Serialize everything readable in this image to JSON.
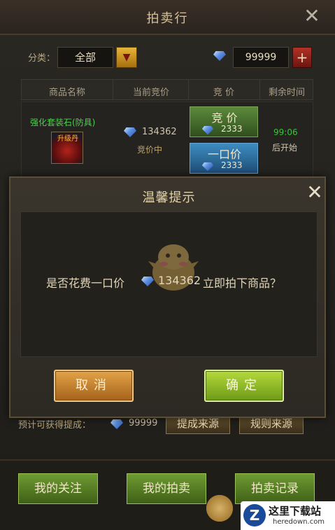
{
  "window": {
    "title": "拍卖行",
    "close_icon": "close-icon"
  },
  "filter": {
    "label": "分类：",
    "selected": "全部",
    "dropdown_icon": "triangle-down-icon"
  },
  "currency": {
    "icon": "diamond-icon",
    "amount": "99999",
    "add_icon": "plus-icon"
  },
  "table": {
    "headers": [
      "商品名称",
      "当前竞价",
      "竞  价",
      "剩余时间"
    ],
    "rows": [
      {
        "item_name": "强化套装石(防具)",
        "item_icon_label": "升级丹",
        "current_bid": "134362",
        "bid_status": "竞价中",
        "bid_button": "竞  价",
        "bid_button_amount": "2333",
        "buyout_button": "一口价",
        "buyout_button_amount": "2333",
        "time_remaining": "99:06",
        "time_note": "后开始"
      }
    ]
  },
  "footer": {
    "estimate_label": "预计可获得提成：",
    "estimate_value": "99999",
    "btn_commission_source": "提成来源",
    "btn_rules_source": "规则来源",
    "tabs": [
      "我的关注",
      "我的拍卖",
      "拍卖记录"
    ]
  },
  "watermark": {
    "cn": "这里下载站",
    "en": "heredown.com",
    "logo": "Z"
  },
  "modal": {
    "title": "温馨提示",
    "message_prefix": "是否花费一口价",
    "message_amount": "134362",
    "message_suffix": "立即拍下商品？",
    "cancel_label": "取消",
    "confirm_label": "确定"
  },
  "colors": {
    "accent_green": "#6f9b33",
    "accent_gold": "#e3a449",
    "item_name_green": "#4fd04f",
    "time_green": "#39c339"
  }
}
